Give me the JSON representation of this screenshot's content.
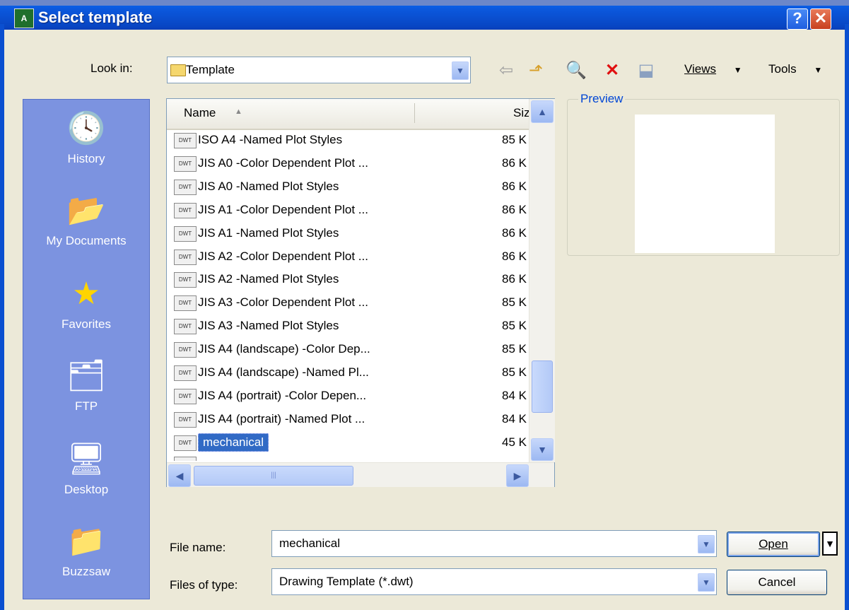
{
  "window": {
    "title": "Select template",
    "icon": "autocad-app-icon",
    "help_label": "?",
    "close_label": "✕"
  },
  "lookin": {
    "label": "Look in:",
    "value": "Template",
    "views_label": "Views",
    "tools_label": "Tools"
  },
  "toolbar_icons": [
    "back-arrow-icon",
    "up-folder-icon",
    "search-web-icon",
    "delete-icon",
    "create-folder-icon"
  ],
  "places": [
    {
      "label": "History",
      "icon": "history-icon"
    },
    {
      "label": "My Documents",
      "icon": "my-documents-icon"
    },
    {
      "label": "Favorites",
      "icon": "favorites-star-icon"
    },
    {
      "label": "FTP",
      "icon": "ftp-icon"
    },
    {
      "label": "Desktop",
      "icon": "desktop-icon"
    },
    {
      "label": "Buzzsaw",
      "icon": "buzzsaw-icon"
    }
  ],
  "list": {
    "col_name": "Name",
    "col_size": "Siz",
    "rows": [
      {
        "name": "ISO A4 -Named Plot Styles",
        "size": "85 K"
      },
      {
        "name": "JIS A0 -Color Dependent Plot ...",
        "size": "86 K"
      },
      {
        "name": "JIS A0 -Named Plot Styles",
        "size": "86 K"
      },
      {
        "name": "JIS A1 -Color Dependent Plot ...",
        "size": "86 K"
      },
      {
        "name": "JIS A1 -Named Plot Styles",
        "size": "86 K"
      },
      {
        "name": "JIS A2 -Color Dependent Plot ...",
        "size": "86 K"
      },
      {
        "name": "JIS A2 -Named Plot Styles",
        "size": "86 K"
      },
      {
        "name": "JIS A3 -Color Dependent Plot ...",
        "size": "85 K"
      },
      {
        "name": "JIS A3 -Named Plot Styles",
        "size": "85 K"
      },
      {
        "name": "JIS A4 (landscape) -Color Dep...",
        "size": "85 K"
      },
      {
        "name": "JIS A4 (landscape) -Named Pl...",
        "size": "85 K"
      },
      {
        "name": "JIS A4 (portrait) -Color Depen...",
        "size": "84 K"
      },
      {
        "name": "JIS A4 (portrait) -Named Plot ...",
        "size": "84 K"
      },
      {
        "name": "mechanical",
        "size": "45 K",
        "selected": true
      }
    ],
    "file_icon_text": "DWT"
  },
  "preview": {
    "label": "Preview"
  },
  "filename": {
    "label": "File name:",
    "value": "mechanical"
  },
  "filetype": {
    "label": "Files of type:",
    "value": "Drawing Template (*.dwt)"
  },
  "buttons": {
    "open": "Open",
    "cancel": "Cancel"
  },
  "colors": {
    "titlebar": "#0a4fd0",
    "places_bg": "#7c93e0",
    "selection": "#316ac5",
    "dialog_bg": "#ece9d8"
  }
}
